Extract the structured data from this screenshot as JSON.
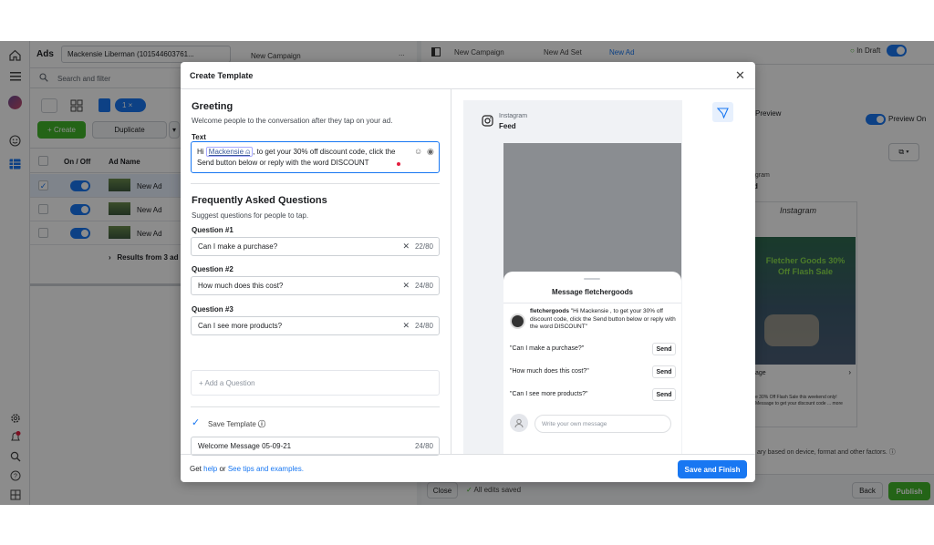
{
  "topbar": {
    "ads_label": "Ads",
    "account_name": "Mackensie Liberman (101544603761...",
    "campaign_tab": "New Campaign",
    "more": "..."
  },
  "left_panel": {
    "search_placeholder": "Search and filter",
    "selected_count": "1",
    "create_label": "+ Create",
    "duplicate_label": "Duplicate",
    "col_onoff": "On / Off",
    "col_adname": "Ad Name",
    "rows": [
      {
        "name": "New Ad",
        "checked": true
      },
      {
        "name": "New Ad",
        "checked": false
      },
      {
        "name": "New Ad",
        "checked": false
      }
    ],
    "results_label": "Results from 3 ad"
  },
  "right_panel": {
    "breadcrumb": [
      "New Campaign",
      "New Ad Set",
      "New Ad"
    ],
    "status": "In Draft",
    "preview_tab": "Preview",
    "preview_on_label": "Preview On",
    "brand_text": "Fletcher Goods 30% Off Flash Sale",
    "ig_script": "Instagram",
    "story_caption_short": "e 30% Off Flash Sale this weekend only!",
    "story_caption_short2": "Message to get your discount code ... more",
    "footnote": "ary based on device, format and other factors.",
    "close_label": "Close",
    "saved_label": "All edits saved",
    "back_label": "Back",
    "publish_label": "Publish",
    "side_label_1": "agram",
    "side_label_2": "d",
    "age_label": "age"
  },
  "modal": {
    "title": "Create Template",
    "greeting": {
      "title": "Greeting",
      "subtitle": "Welcome people to the conversation after they tap on your ad.",
      "text_label": "Text",
      "text_prefix": "Hi",
      "name_token": "Mackensie",
      "text_rest": ", to get your 30% off discount code, click the",
      "text_line2": "Send button below or reply with the word DISCOUNT"
    },
    "faq": {
      "title": "Frequently Asked Questions",
      "subtitle": "Suggest questions for people to tap.",
      "questions": [
        {
          "label": "Question #1",
          "value": "Can I make a purchase?",
          "count": "22/80"
        },
        {
          "label": "Question #2",
          "value": "How much does this cost?",
          "count": "24/80"
        },
        {
          "label": "Question #3",
          "value": "Can I see more products?",
          "count": "24/80"
        }
      ],
      "add_question": "+ Add a Question"
    },
    "save_template": {
      "label": "Save Template",
      "value": "Welcome Message 05-09-21",
      "count": "24/80"
    },
    "preview": {
      "platform": "Instagram",
      "placement": "Feed",
      "sheet_title": "Message fletchergoods",
      "sender": "fletchergoods",
      "message": "\"Hi Mackensie , to get your 30% off discount code, click the Send button below or reply with the word DISCOUNT\"",
      "questions": [
        "\"Can I make a purchase?\"",
        "\"How much does this cost?\"",
        "\"Can I see more products?\""
      ],
      "send_label": "Send",
      "input_placeholder": "Write your own message"
    },
    "footer": {
      "get_label": "Get ",
      "help_link": "help",
      "or_label": " or ",
      "tips_link": "See tips and examples.",
      "primary_button": "Save and Finish"
    }
  },
  "colors": {
    "accent": "#1877f2",
    "publish": "#42b72a",
    "create": "#42b72a",
    "promo": "#5fa839"
  }
}
